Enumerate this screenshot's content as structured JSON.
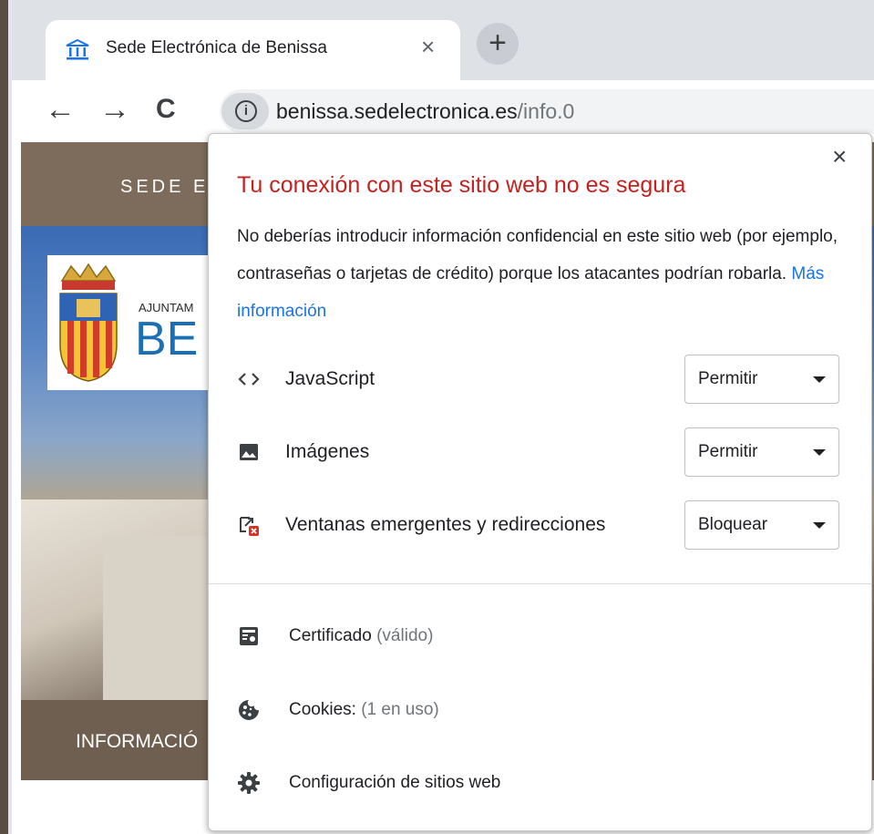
{
  "tab": {
    "title": "Sede Electrónica de Benissa",
    "close_symbol": "×",
    "new_tab_symbol": "+",
    "favicon": "institution-icon"
  },
  "toolbar": {
    "back_symbol": "←",
    "forward_symbol": "→",
    "reload_symbol": "C",
    "info_symbol": "i",
    "url_host": "benissa.sedelectronica.es",
    "url_path": "/info.0"
  },
  "page": {
    "header_text": "SEDE E",
    "logo_small": "AJUNTAM",
    "logo_big": "BE",
    "nav_text": "INFORMACIÓ"
  },
  "popup": {
    "close_symbol": "×",
    "title": "Tu conexión con este sitio web no es segura",
    "body": "No deberías introducir información confidencial en este sitio web (por ejemplo, contraseñas o tarjetas de crédito) porque los atacantes podrían robarla.",
    "more_info": "Más información",
    "permissions": [
      {
        "label": "JavaScript",
        "value": "Permitir",
        "icon": "code-icon"
      },
      {
        "label": "Imágenes",
        "value": "Permitir",
        "icon": "image-icon"
      },
      {
        "label": "Ventanas emergentes y redirecciones",
        "value": "Bloquear",
        "icon": "popup-blocked-icon"
      }
    ],
    "links": [
      {
        "label": "Certificado",
        "sub": "(válido)",
        "icon": "certificate-icon"
      },
      {
        "label": "Cookies:",
        "sub": "(1 en uso)",
        "icon": "cookie-icon"
      },
      {
        "label": "Configuración de sitios web",
        "sub": "",
        "icon": "gear-icon"
      }
    ]
  },
  "colors": {
    "title_red": "#c5221f",
    "link_blue": "#1a73e8",
    "site_header": "#7d6b5b",
    "tab_strip": "#dee1e6"
  }
}
